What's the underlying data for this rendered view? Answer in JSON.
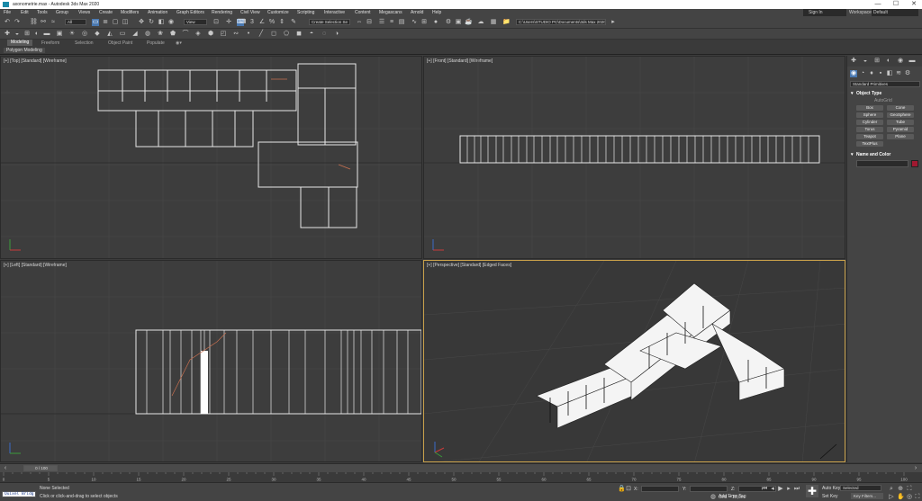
{
  "window": {
    "title": "axonometrie.max - Autodesk 3ds Max 2020",
    "minimize": "—",
    "maximize": "☐",
    "close": "✕"
  },
  "menu": {
    "items": [
      "File",
      "Edit",
      "Tools",
      "Group",
      "Views",
      "Create",
      "Modifiers",
      "Animation",
      "Graph Editors",
      "Rendering",
      "Civil View",
      "Customize",
      "Scripting",
      "Interactive",
      "Content",
      "Megascans",
      "Arnold",
      "Help"
    ],
    "signin": "Sign In",
    "workspace_label": "Workspaces:",
    "workspace_value": "Default"
  },
  "toolbar": {
    "selection_filter": "All",
    "reference_coord": "View",
    "named_selection": "Create Selection Se",
    "project_path": "C:\\Users\\STUDIO PC\\Documents\\3ds Max 2020"
  },
  "ribbon": {
    "tabs": [
      "Modeling",
      "Freeform",
      "Selection",
      "Object Paint",
      "Populate"
    ],
    "active_tab": "Modeling",
    "sub_label": "Polygon Modeling"
  },
  "viewports": {
    "top": "[+] [Top] [Standard] [Wireframe]",
    "front": "[+] [Front] [Standard] [Wireframe]",
    "left": "[+] [Left] [Standard] [Wireframe]",
    "perspective": "[+] [Perspective] [Standard] [Edged Faces]"
  },
  "command_panel": {
    "dropdown": "Standard Primitives",
    "object_type_header": "Object Type",
    "autogrid": "AutoGrid",
    "buttons": [
      "Box",
      "Cone",
      "Sphere",
      "GeoSphere",
      "Cylinder",
      "Tube",
      "Torus",
      "Pyramid",
      "Teapot",
      "Plane",
      "TextPlus"
    ],
    "name_color_header": "Name and Color",
    "color_swatch": "#a01830"
  },
  "timeline": {
    "frame_display": "0 / 100",
    "ruler_ticks": [
      "0",
      "5",
      "10",
      "15",
      "20",
      "25",
      "30",
      "35",
      "40",
      "45",
      "50",
      "55",
      "60",
      "65",
      "70",
      "75",
      "80",
      "85",
      "90",
      "95",
      "100"
    ]
  },
  "status": {
    "maxscript": "Quixel Bridg",
    "selection": "None Selected",
    "prompt": "Click or click-and-drag to select objects",
    "x_label": "X:",
    "y_label": "Y:",
    "z_label": "Z:",
    "grid": "Grid = 10,0m",
    "add_time_tag": "Add Time Tag",
    "auto_key": "Auto Key",
    "set_key": "Set Key",
    "selected": "Selected",
    "key_filters": "Key Filters..."
  },
  "colors": {
    "accent": "#4a78b0",
    "active_viewport": "#c8a04a",
    "background": "#3c3c3c"
  }
}
